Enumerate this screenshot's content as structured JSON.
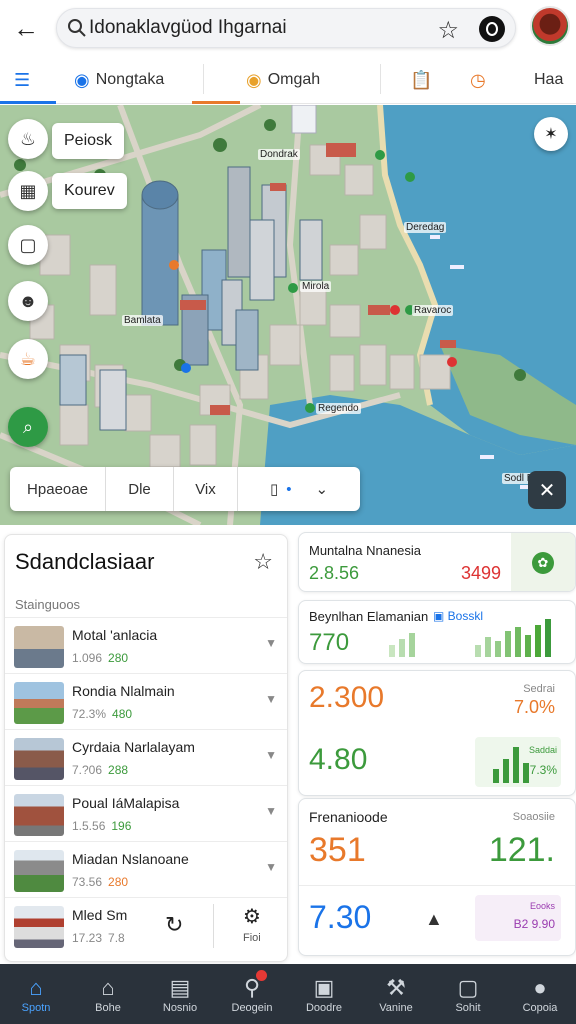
{
  "search": {
    "value": "Idonaklavgüod Ihgarnai"
  },
  "tabs": [
    {
      "label": "Nongtaka"
    },
    {
      "label": "Omgah"
    },
    {
      "label": "Haa"
    }
  ],
  "map": {
    "chips": [
      "Peiosk",
      "Kourev"
    ],
    "labels": [
      "Dondrak",
      "Deredag",
      "Bamlata",
      "Mirola",
      "Ravaroc",
      "Regendo",
      "Sodl Bani"
    ],
    "filters": [
      "Hpaeoae",
      "Dle",
      "Vix"
    ]
  },
  "left_panel": {
    "title": "Sdandclasiaar",
    "subtitle": "Stainguoos",
    "items": [
      {
        "name": "Motal 'anlacia",
        "meta": "1.096",
        "value": "280"
      },
      {
        "name": "Rondia Nlalmain",
        "meta": "72.3%",
        "value": "480"
      },
      {
        "name": "Cyrdaia Narlalayam",
        "meta": "7.?06",
        "value": "288"
      },
      {
        "name": "Poual IáMalapisa",
        "meta": "1.5.56",
        "value": "196"
      },
      {
        "name": "Miadan Nslanoane",
        "meta": "73.56",
        "value": "280"
      },
      {
        "name": "Mled Sm",
        "meta": "17.23",
        "value": "7.8"
      }
    ],
    "last_row_action": "Fioi"
  },
  "cards": {
    "card1": {
      "title": "Muntalna Nnanesia",
      "value1": "2.8.56",
      "value2": "3499"
    },
    "card2": {
      "title": "Beynlhan Elamanian",
      "tag": "Bosskl",
      "value": "770"
    },
    "card3": {
      "value_big": "2.300",
      "label": "Sedrai",
      "pct": "7.0%",
      "value2": "4.80",
      "mini_label": "Saddai",
      "mini_pct": "7.3%"
    },
    "card4": {
      "title": "Frenanioode",
      "label": "Soaosiie",
      "value1": "351",
      "value2": "121.",
      "value3": "7.30",
      "mini_label": "Eooks",
      "mini_value": "B2 9.90"
    }
  },
  "bottom_nav": [
    {
      "label": "Spotn"
    },
    {
      "label": "Bohe"
    },
    {
      "label": "Nosnio"
    },
    {
      "label": "Deogein"
    },
    {
      "label": "Doodre"
    },
    {
      "label": "Vanine"
    },
    {
      "label": "Sohit"
    },
    {
      "label": "Copoia"
    }
  ],
  "colors": {
    "accent": "#1a73e8",
    "green": "#3c9a3c",
    "orange": "#e8792b",
    "nav_bg": "#2a323b"
  }
}
